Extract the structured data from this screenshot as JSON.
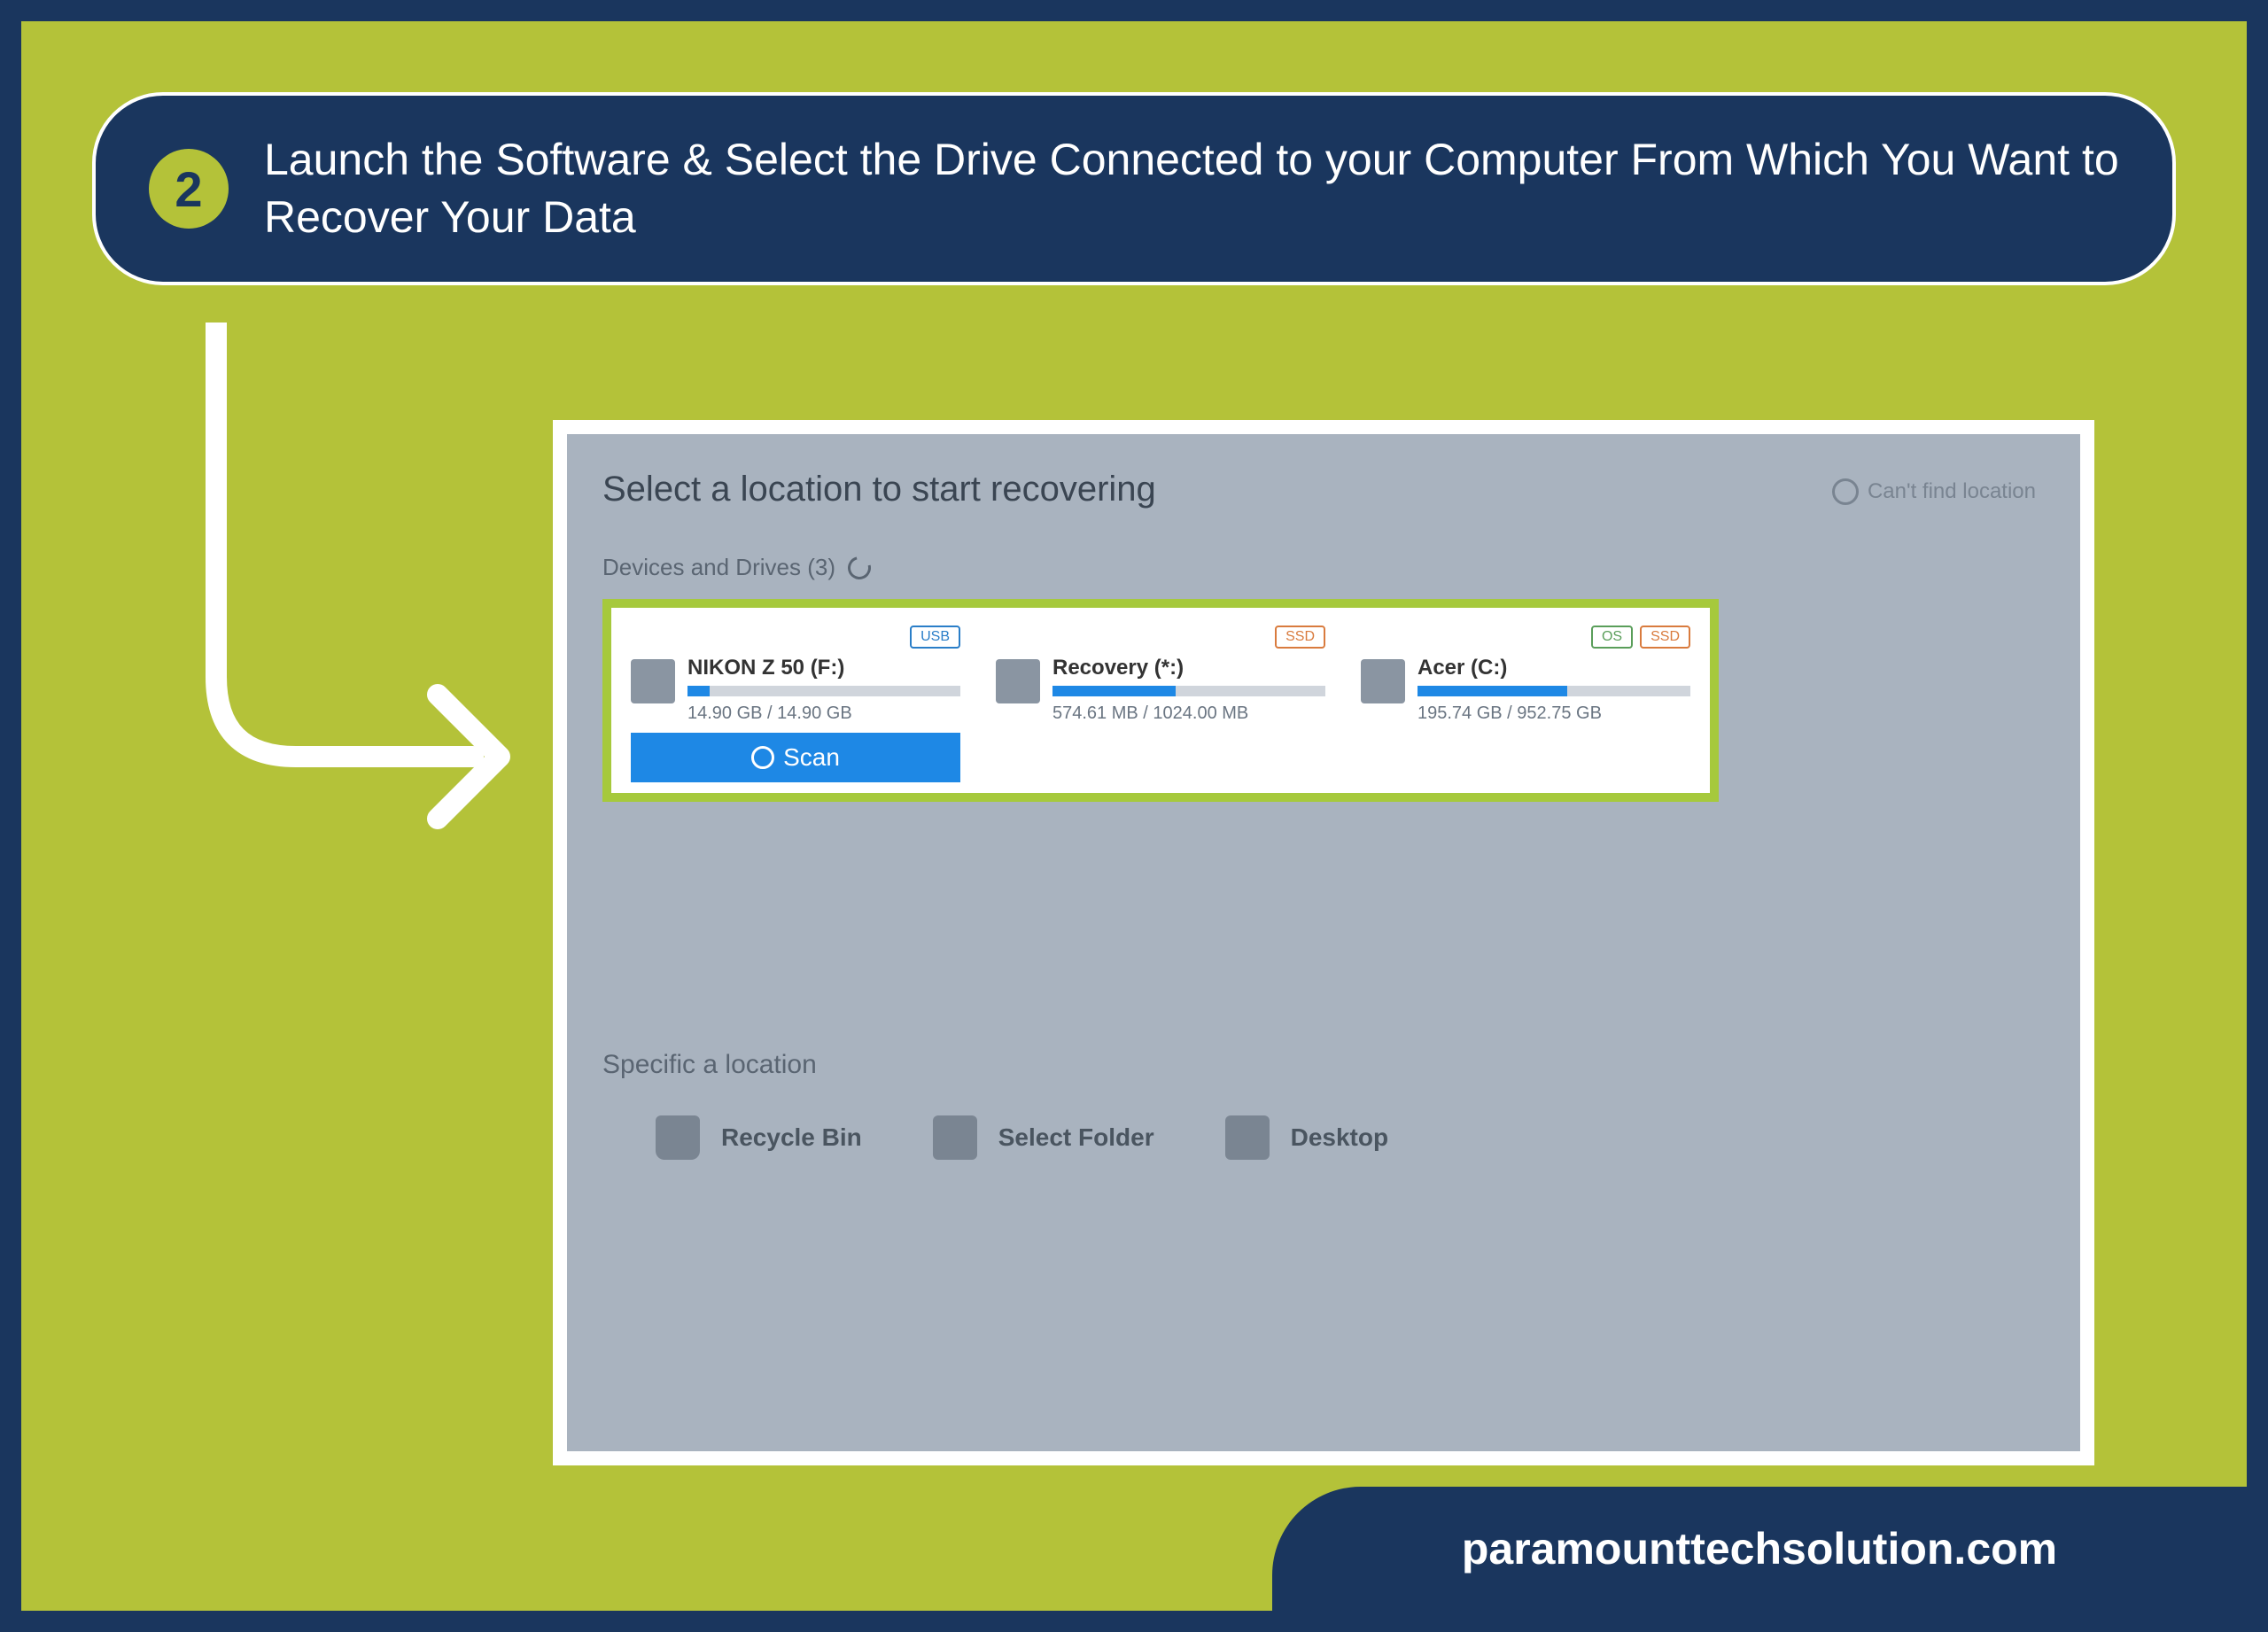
{
  "step": {
    "number": "2",
    "text": "Launch the Software & Select the Drive Connected to your Computer From Which You Want to Recover Your Data"
  },
  "app": {
    "title": "Select a location to start recovering",
    "help_link": "Can't find location",
    "devices_label": "Devices and Drives (3)",
    "specific_label": "Specific a location"
  },
  "drives": {
    "0": {
      "name": "NIKON Z 50 (F:)",
      "size": "14.90 GB / 14.90 GB",
      "tag1": "USB",
      "scan": "Scan"
    },
    "1": {
      "name": "Recovery (*:)",
      "size": "574.61 MB / 1024.00 MB",
      "tag1": "SSD"
    },
    "2": {
      "name": "Acer (C:)",
      "size": "195.74 GB / 952.75 GB",
      "tag1": "OS",
      "tag2": "SSD"
    }
  },
  "locations": {
    "0": "Recycle Bin",
    "1": "Select Folder",
    "2": "Desktop"
  },
  "footer": "paramounttechsolution.com"
}
